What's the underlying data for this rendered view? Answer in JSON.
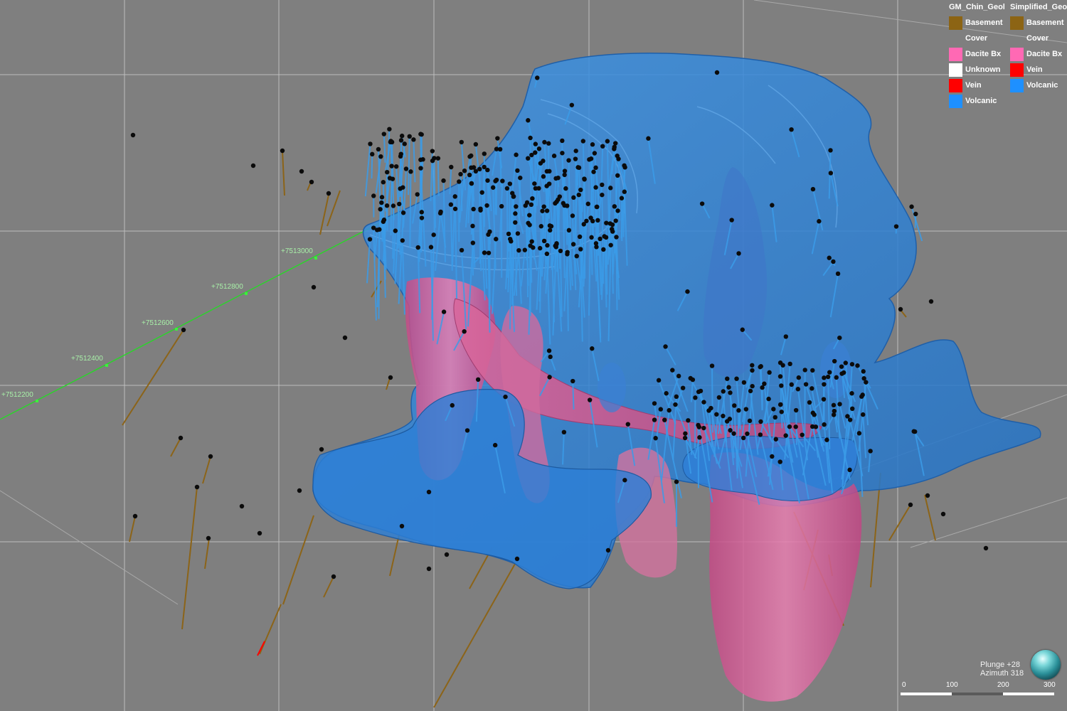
{
  "scene": {
    "northing_labels": [
      "+7512200",
      "+7512400",
      "+7512600",
      "+7512800",
      "+7513000"
    ],
    "marker_label": "0",
    "colors": {
      "background": "#7f7f7f",
      "grid": "#b9b9b9",
      "volcanic_solid": "#2f83d6",
      "dacite_solid": "#d05a93",
      "basement": "#8c6418",
      "trace": "#3b9be8",
      "collar": "#0a0a0a",
      "section_line": "#2bd42b",
      "section_text": "#a8f0a8"
    }
  },
  "legends": [
    {
      "title": "GM_Chin_Geol",
      "items": [
        {
          "label": "Basement",
          "color": "#8c6414"
        },
        {
          "label": "Cover",
          "color": null
        },
        {
          "label": "Dacite Bx",
          "color": "#ff69b4"
        },
        {
          "label": "Unknown",
          "color": "#ffffff"
        },
        {
          "label": "Vein",
          "color": "#ff0000"
        },
        {
          "label": "Volcanic",
          "color": "#1e90ff"
        }
      ]
    },
    {
      "title": "Simplified_Geology",
      "items": [
        {
          "label": "Basement",
          "color": "#8c6414"
        },
        {
          "label": "Cover",
          "color": null
        },
        {
          "label": "Dacite Bx",
          "color": "#ff69b4"
        },
        {
          "label": "Vein",
          "color": "#ff0000"
        },
        {
          "label": "Volcanic",
          "color": "#1e90ff"
        }
      ]
    }
  ],
  "view": {
    "plunge_text": "Plunge +28",
    "azimuth_text": "Azimuth 318"
  },
  "scale_bar": {
    "labels": [
      "0",
      "100",
      "200",
      "300"
    ]
  }
}
